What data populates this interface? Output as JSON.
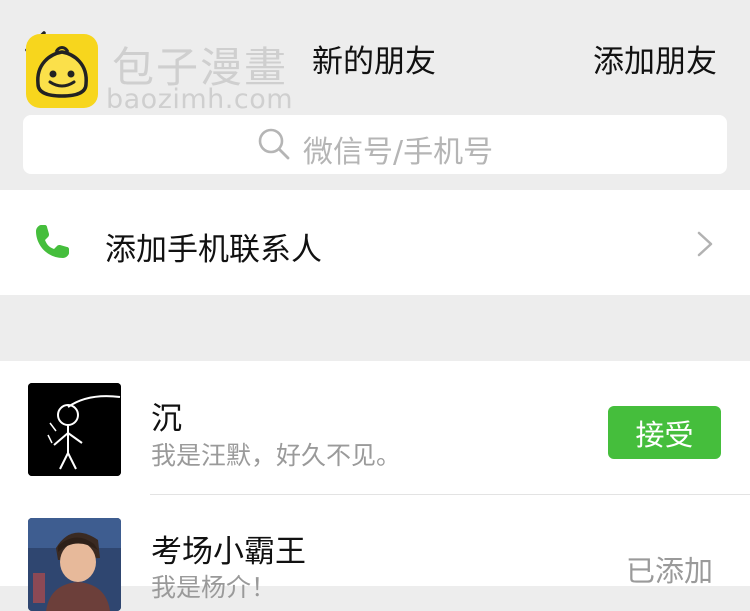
{
  "header": {
    "title": "新的朋友",
    "action_label": "添加朋友"
  },
  "watermark": {
    "cn": "包子漫畫",
    "url": "baozimh.com"
  },
  "search": {
    "placeholder": "微信号/手机号"
  },
  "phone_contacts": {
    "label": "添加手机联系人"
  },
  "requests": [
    {
      "name": "沉",
      "message": "我是汪默，好久不见。",
      "action": "接受"
    },
    {
      "name": "考场小霸王",
      "message": "我是杨介！",
      "status": "已添加"
    }
  ],
  "colors": {
    "accent_green": "#45be3c",
    "phone_icon_green": "#45be3c",
    "background": "#ededed"
  },
  "icons": [
    "back-chevron-icon",
    "search-icon",
    "phone-icon",
    "chevron-right-icon"
  ]
}
